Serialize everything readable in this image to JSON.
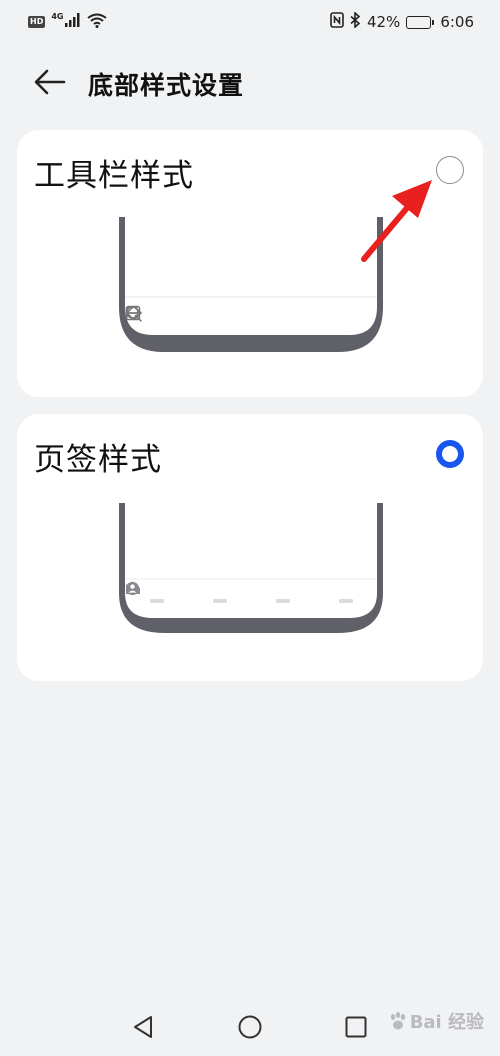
{
  "status_bar": {
    "hd": "HD",
    "network": "4G",
    "battery_percent": "42%",
    "battery_level": 0.42,
    "time": "6:06",
    "icons": [
      "signal-icon",
      "wifi-icon",
      "nfc-icon",
      "bluetooth-icon",
      "battery-icon"
    ]
  },
  "header": {
    "title": "底部样式设置",
    "back_icon": "back-arrow-icon"
  },
  "options": [
    {
      "title": "工具栏样式",
      "selected": false,
      "preview_icons": [
        "back-icon",
        "forward-icon",
        "search-icon",
        "tabs-icon",
        "menu-icon"
      ]
    },
    {
      "title": "页签样式",
      "selected": true,
      "preview_icons": [
        "home-icon",
        "video-icon",
        "discover-icon",
        "profile-icon"
      ]
    }
  ],
  "annotation": {
    "color": "#e8201e",
    "icon": "red-arrow-icon"
  },
  "system_nav": {
    "icons": [
      "nav-back-icon",
      "nav-home-icon",
      "nav-recent-icon"
    ]
  },
  "watermark": {
    "text": "Bai 经验",
    "icon": "baidu-paw-icon"
  },
  "colors": {
    "background": "#f1f2f4",
    "card": "#ffffff",
    "accent": "#1856f0",
    "phone_frame": "#5f6068"
  }
}
